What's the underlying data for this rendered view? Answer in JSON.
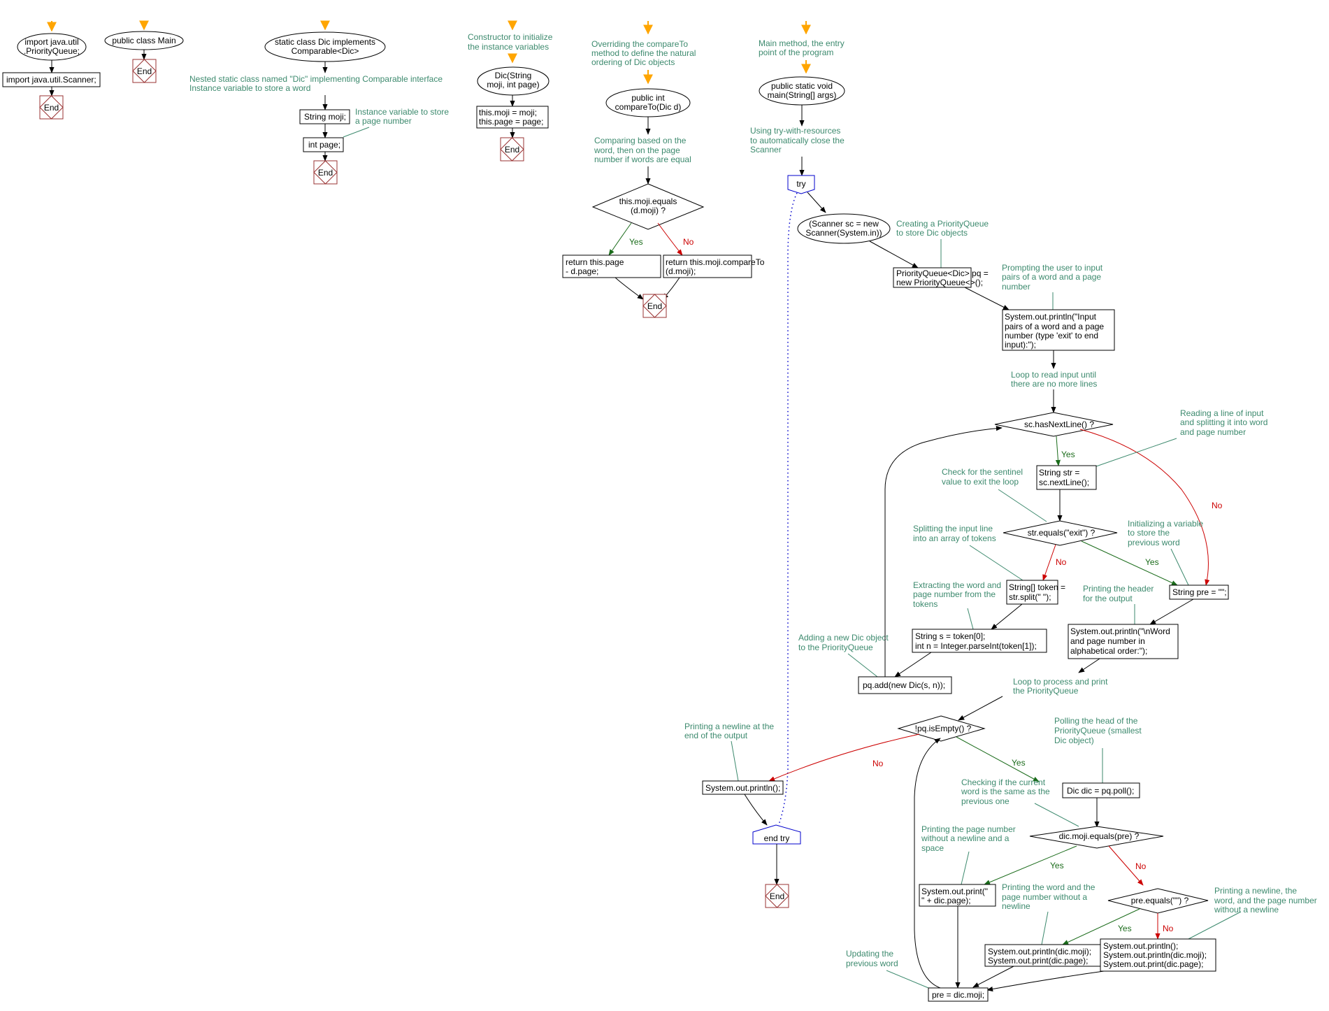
{
  "colors": {
    "comment": "#3d8a6e",
    "yes": "#1a6b1a",
    "no": "#cc0000",
    "end_border": "#993333",
    "try_border": "#0000cc",
    "entry_arrow": "#ffa500"
  },
  "labels": {
    "yes": "Yes",
    "no": "No",
    "end": "End"
  },
  "flows": {
    "imports": {
      "start": [
        "import java.util",
        ".PriorityQueue;"
      ],
      "step": "import java.util.Scanner;"
    },
    "main_class": {
      "start": "public class Main"
    },
    "dic_class": {
      "start": [
        "static class Dic implements",
        "Comparable<Dic>"
      ],
      "comment": [
        "Nested static class named \"Dic\" implementing Comparable interface",
        "Instance variable to store a word"
      ],
      "field1": "String moji;",
      "field2": "int page;",
      "field2_comment": [
        "Instance variable to store",
        "a page number"
      ]
    },
    "constructor": {
      "comment": [
        "Constructor to initialize",
        "the instance variables"
      ],
      "start": [
        "Dic(String",
        "moji, int page)"
      ],
      "body": [
        "this.moji = moji;",
        "this.page = page;"
      ]
    },
    "compare_to": {
      "comment": [
        "Overriding the compareTo",
        "method to define the natural",
        "ordering of Dic objects"
      ],
      "start": [
        "public int",
        "compareTo(Dic d)"
      ],
      "comment2": [
        "Comparing based on the",
        "word, then on the page",
        "number if words are equal"
      ],
      "decision": [
        "this.moji.equals",
        "(d.moji) ?"
      ],
      "yes_box": [
        "return this.page",
        "- d.page;"
      ],
      "no_box": [
        "return this.moji.compareTo",
        "(d.moji);"
      ]
    },
    "main_method": {
      "comment": [
        "Main method, the entry",
        "point of the program"
      ],
      "start": [
        "public static void",
        "main(String[] args)"
      ],
      "try_comment": [
        "Using try-with-resources",
        "to automatically close the",
        "Scanner"
      ],
      "try_label": "try",
      "end_try_label": "end try",
      "scanner": [
        "(Scanner sc = new",
        "Scanner(System.in))"
      ],
      "pq_comment": [
        "Creating a PriorityQueue",
        "to store Dic objects"
      ],
      "pq_box": [
        "PriorityQueue<Dic> pq =",
        "new PriorityQueue<>();"
      ],
      "prompt_comment": [
        "Prompting the user to input",
        "pairs of a word and a page",
        "number"
      ],
      "prompt_box": [
        "System.out.println(\"Input",
        "pairs of a word and a page",
        "number (type 'exit' to end",
        "input):\");"
      ],
      "loop_comment": [
        "Loop to read input until",
        "there are no more lines"
      ],
      "has_next": "sc.hasNextLine() ?",
      "read_comment": [
        "Reading a line of input",
        "and splitting it into word",
        "and page number"
      ],
      "str_box": [
        "String str =",
        "sc.nextLine();"
      ],
      "check_comment": [
        "Check for the sentinel",
        "value to exit the loop"
      ],
      "exit_decision": "str.equals(\"exit\") ?",
      "split_comment": [
        "Splitting the input line",
        "into an array of tokens"
      ],
      "init_comment": [
        "Initializing a variable",
        "to store the",
        "previous word"
      ],
      "token_box": [
        "String[] token =",
        "str.split(\" \");"
      ],
      "pre_box": "String pre = \"\";",
      "extract_comment": [
        "Extracting the word and",
        "page number from the",
        "tokens"
      ],
      "header_comment": [
        "Printing the header",
        "for the output"
      ],
      "parse_box": [
        "String s = token[0];",
        "int n = Integer.parseInt(token[1]);"
      ],
      "header_box": [
        "System.out.println(\"\\nWord",
        "and page number in",
        "alphabetical order:\");"
      ],
      "add_comment": [
        "Adding a new Dic object",
        "to the PriorityQueue"
      ],
      "add_box": "pq.add(new Dic(s, n));",
      "process_comment": [
        "Loop to process and print",
        "the PriorityQueue"
      ],
      "empty_decision": "!pq.isEmpty() ?",
      "poll_comment": [
        "Polling the head of the",
        "PriorityQueue (smallest",
        "Dic object)"
      ],
      "newline_comment": [
        "Printing a newline at the",
        "end of the output"
      ],
      "newline_box": "System.out.println();",
      "poll_box": "Dic dic = pq.poll();",
      "same_comment": [
        "Checking if the current",
        "word is the same as the",
        "previous one"
      ],
      "same_decision": "dic.moji.equals(pre) ?",
      "page_comment": [
        "Printing the page number",
        "without a newline and a",
        "space"
      ],
      "page_box": [
        "System.out.print(\"",
        "\" + dic.page);"
      ],
      "word_comment": [
        "Printing the word and the",
        "page number without a",
        "newline"
      ],
      "pre_empty_decision": "pre.equals(\"\") ?",
      "nl_word_comment": [
        "Printing a newline, the",
        "word, and the page number",
        "without a newline"
      ],
      "word_box": [
        "System.out.println(dic.moji);",
        "System.out.print(dic.page);"
      ],
      "nl_word_box": [
        "System.out.println();",
        "System.out.println(dic.moji);",
        "System.out.print(dic.page);"
      ],
      "update_comment": [
        "Updating the",
        "previous word"
      ],
      "update_box": "pre = dic.moji;"
    }
  }
}
